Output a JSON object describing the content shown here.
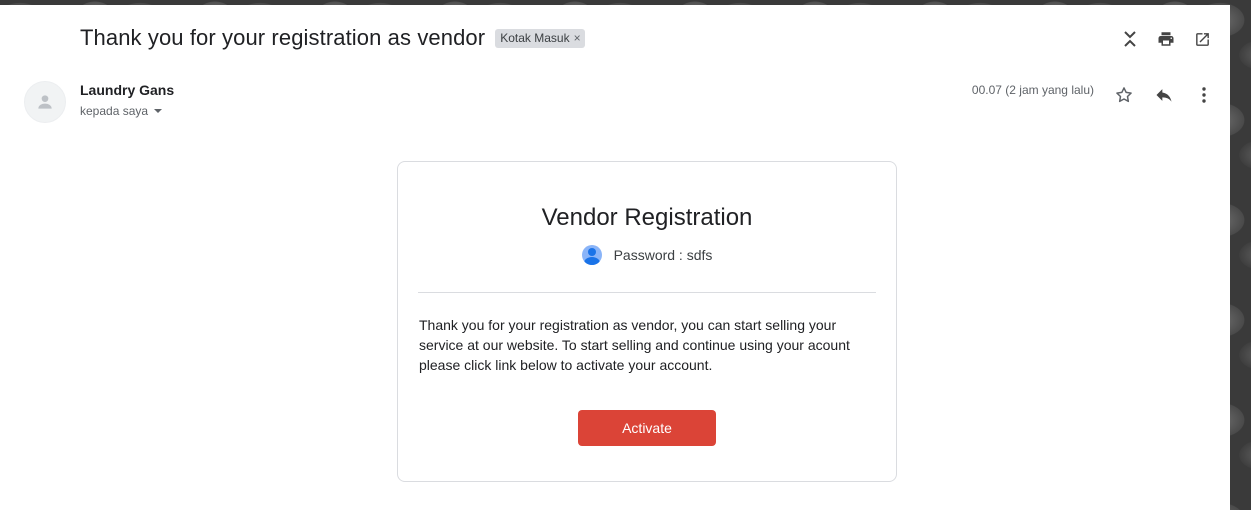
{
  "email": {
    "subject": "Thank you for your registration as vendor",
    "label": "Kotak Masuk",
    "label_remove": "×",
    "sender_name": "Laundry Gans",
    "recipient": "kepada saya",
    "timestamp": "00.07 (2 jam yang lalu)"
  },
  "toolbar": {
    "icons": [
      "collapse-all-icon",
      "print-icon",
      "open-in-new-window-icon"
    ]
  },
  "message_actions": {
    "icons": [
      "star-icon",
      "reply-icon",
      "more-vert-icon"
    ]
  },
  "card": {
    "title": "Vendor Registration",
    "password_line": "Password : sdfs",
    "body": "Thank you for your registration as vendor, you can start selling your service at our website. To start selling and continue using your acount please click link below to activate your account.",
    "button_label": "Activate"
  },
  "colors": {
    "button": "#db4437",
    "label_chip": "#dadce0",
    "avatar_blue": "#1a73e8"
  }
}
